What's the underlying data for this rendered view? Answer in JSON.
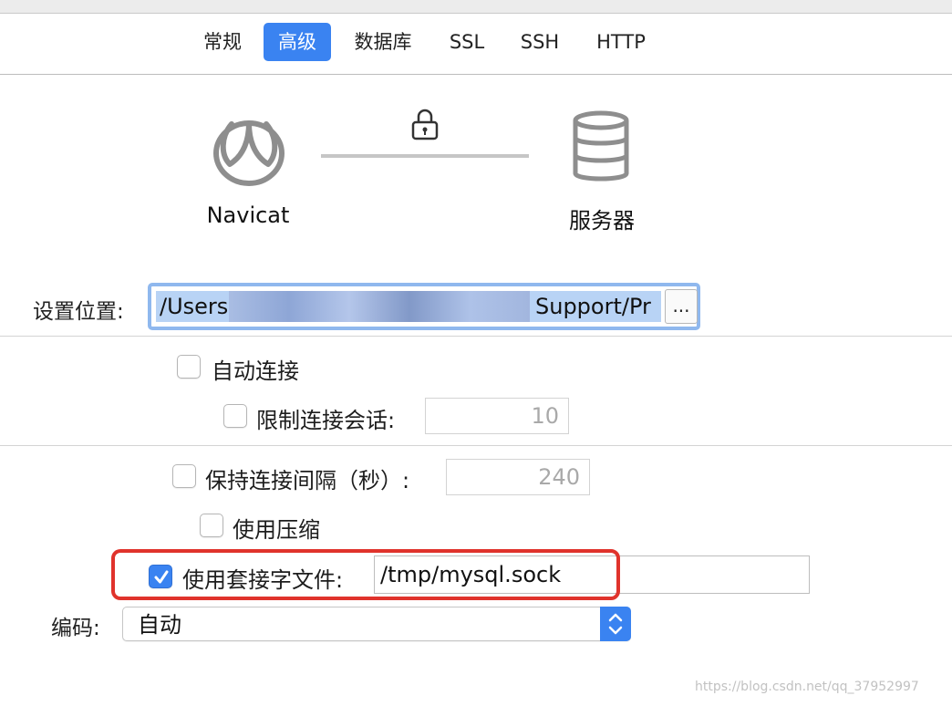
{
  "tabs": [
    {
      "label": "常规",
      "active": false
    },
    {
      "label": "高级",
      "active": true
    },
    {
      "label": "数据库",
      "active": false
    },
    {
      "label": "SSL",
      "active": false
    },
    {
      "label": "SSH",
      "active": false
    },
    {
      "label": "HTTP",
      "active": false
    }
  ],
  "diagram": {
    "client_label": "Navicat",
    "server_label": "服务器",
    "client_icon": "navicat-logo-icon",
    "lock_icon": "lock-icon",
    "server_icon": "database-icon"
  },
  "settings_location": {
    "label": "设置位置:",
    "value_start": "/Users",
    "value_end": "Support/Pr",
    "browse_label": "..."
  },
  "auto_connect": {
    "label": "自动连接",
    "checked": false
  },
  "limit_sessions": {
    "label": "限制连接会话:",
    "checked": false,
    "value": "10"
  },
  "keepalive": {
    "label": "保持连接间隔（秒）:",
    "checked": false,
    "value": "240"
  },
  "compression": {
    "label": "使用压缩",
    "checked": false
  },
  "socket_file": {
    "label": "使用套接字文件:",
    "checked": true,
    "value": "/tmp/mysql.sock"
  },
  "encoding": {
    "label": "编码:",
    "value": "自动"
  },
  "watermark": "https://blog.csdn.net/qq_37952997",
  "colors": {
    "accent": "#3a83f1",
    "highlight": "#e0332c"
  }
}
